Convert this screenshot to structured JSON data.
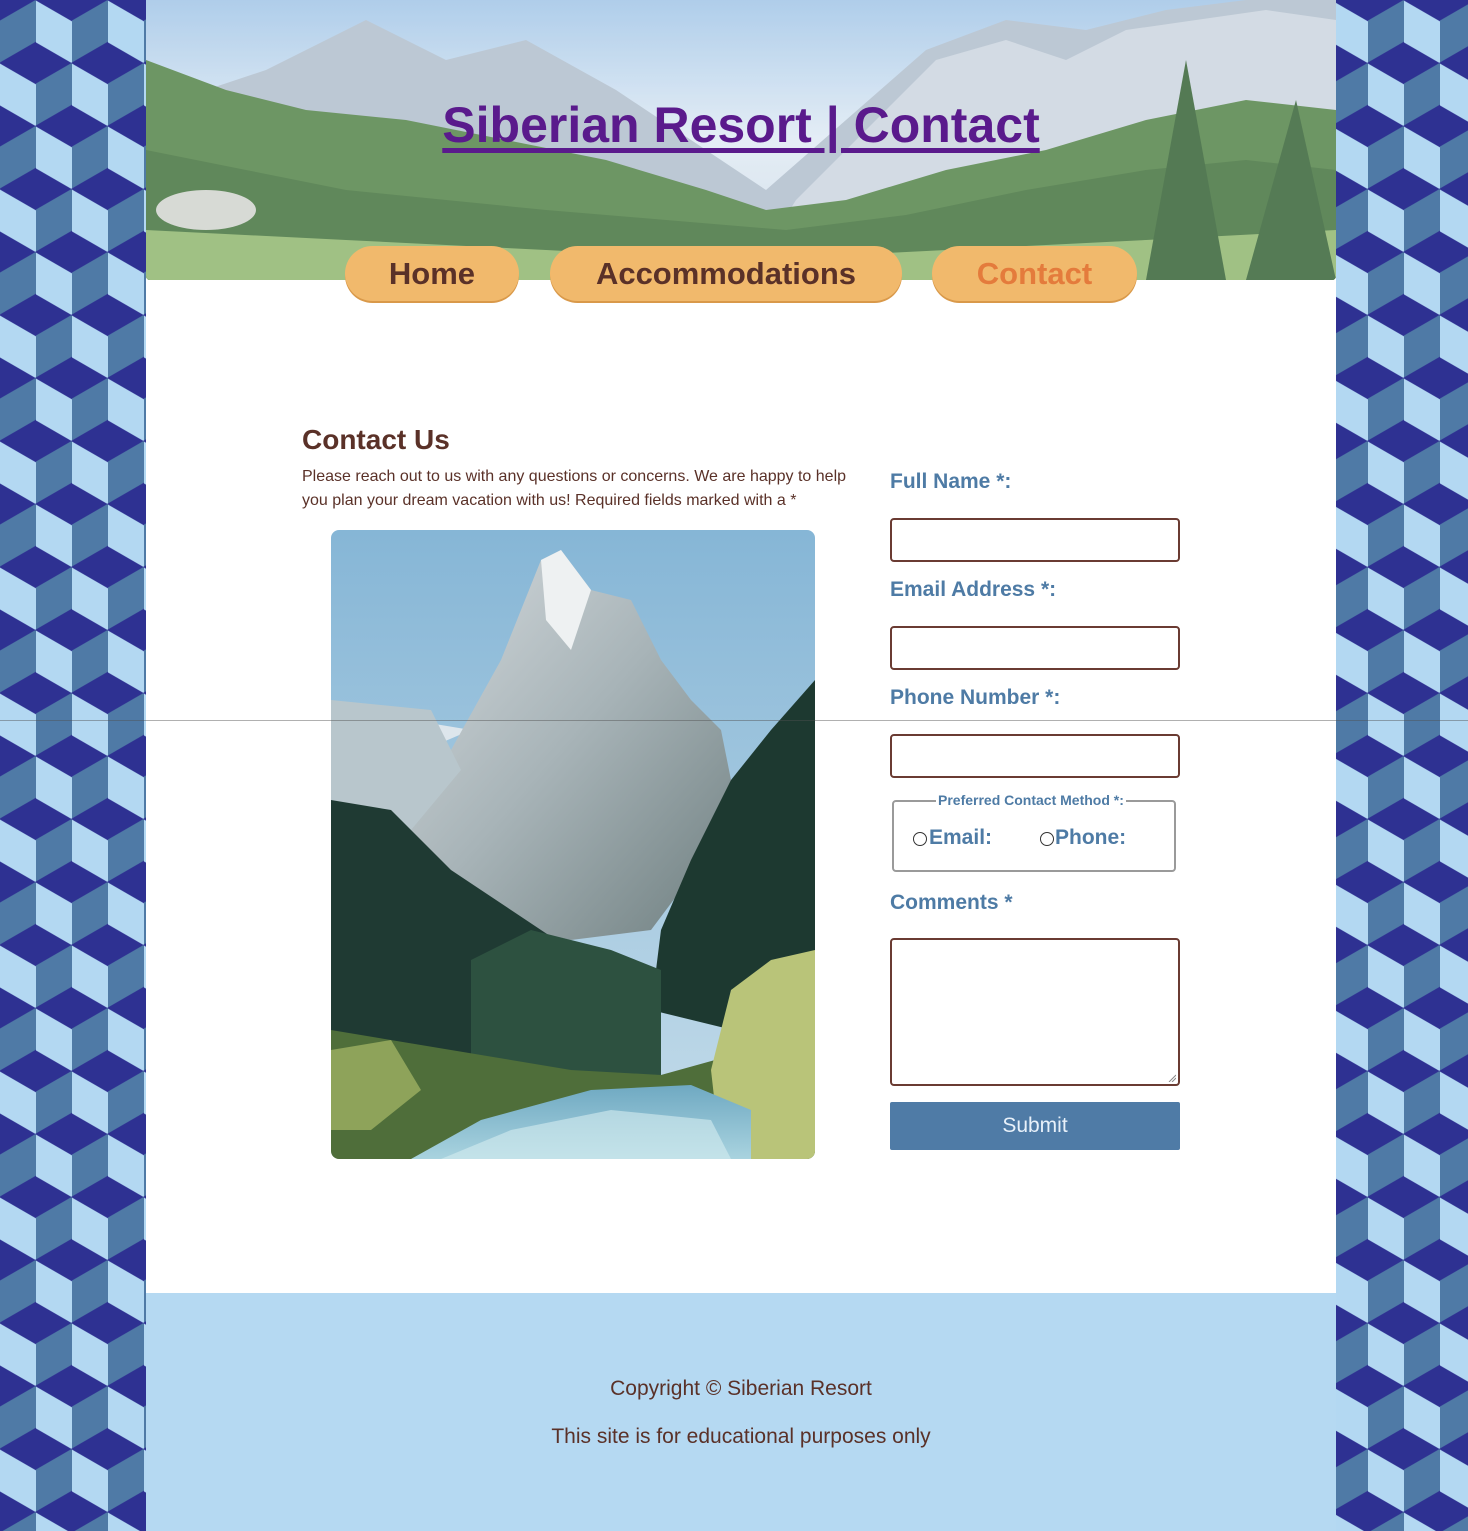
{
  "site": {
    "title": "Siberian Resort | Contact"
  },
  "nav": {
    "items": [
      {
        "label": "Home",
        "active": false
      },
      {
        "label": "Accommodations",
        "active": false
      },
      {
        "label": "Contact",
        "active": true
      }
    ]
  },
  "contact": {
    "heading": "Contact Us",
    "intro": "Please reach out to us with any questions or concerns. We are happy to help you plan your dream vacation with us! Required fields marked with a *"
  },
  "form": {
    "full_name_label": "Full Name *:",
    "full_name_value": "",
    "email_label": "Email Address *:",
    "email_value": "",
    "phone_label": "Phone Number *:",
    "phone_value": "",
    "contact_method_legend": "Preferred Contact Method *:",
    "contact_method_options": [
      "Email:",
      "Phone:"
    ],
    "comments_label": "Comments *",
    "comments_value": "",
    "submit_label": "Submit"
  },
  "footer": {
    "copyright": "Copyright © Siberian Resort",
    "disclaimer": "This site is for educational purposes only"
  },
  "colors": {
    "nav_button": "#f1b96c",
    "nav_active_text": "#e47b3c",
    "brown_text": "#5a3128",
    "label_blue": "#4e7ba5",
    "submit_bg": "#4f7ba6",
    "footer_bg": "#b5d9f2",
    "title_purple": "#5a1a8c"
  }
}
